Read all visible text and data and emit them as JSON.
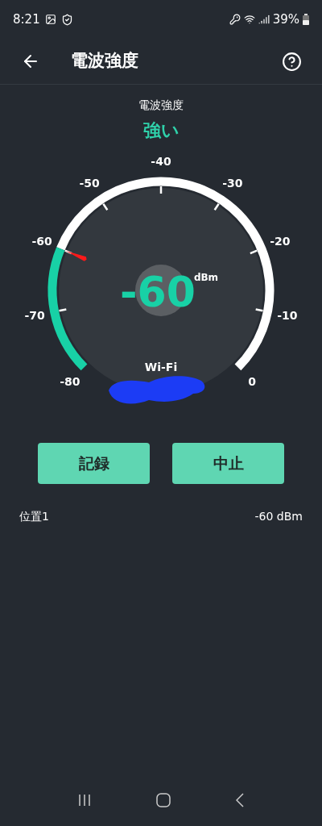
{
  "status_bar": {
    "time": "8:21",
    "battery": "39%"
  },
  "app_bar": {
    "title": "電波強度"
  },
  "signal": {
    "caption": "電波強度",
    "quality": "強い"
  },
  "gauge": {
    "reading": "-60",
    "unit": "dBm",
    "network": "Wi-Fi",
    "scale_labels": [
      "-80",
      "-70",
      "-60",
      "-50",
      "-40",
      "-30",
      "-20",
      "-10",
      "0"
    ]
  },
  "buttons": [
    {
      "label": "記録"
    },
    {
      "label": "中止"
    }
  ],
  "records": [
    {
      "name": "位置1",
      "value": "-60 dBm"
    }
  ]
}
